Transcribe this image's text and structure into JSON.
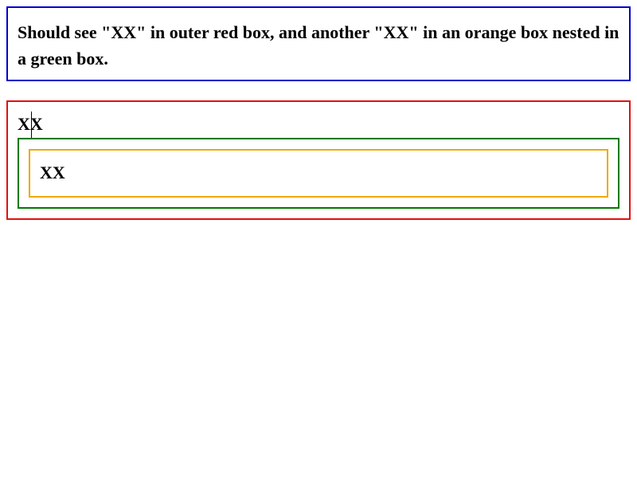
{
  "instructions": {
    "text": "Should see \"XX\" in outer red box, and another \"XX\" in an orange box nested in a green box."
  },
  "outer_box": {
    "text": "XX"
  },
  "inner_box": {
    "text": "XX"
  },
  "colors": {
    "instructions_border": "#0000cc",
    "outer_border": "#e01010",
    "middle_border": "#007a00",
    "inner_border": "#f0a800"
  }
}
